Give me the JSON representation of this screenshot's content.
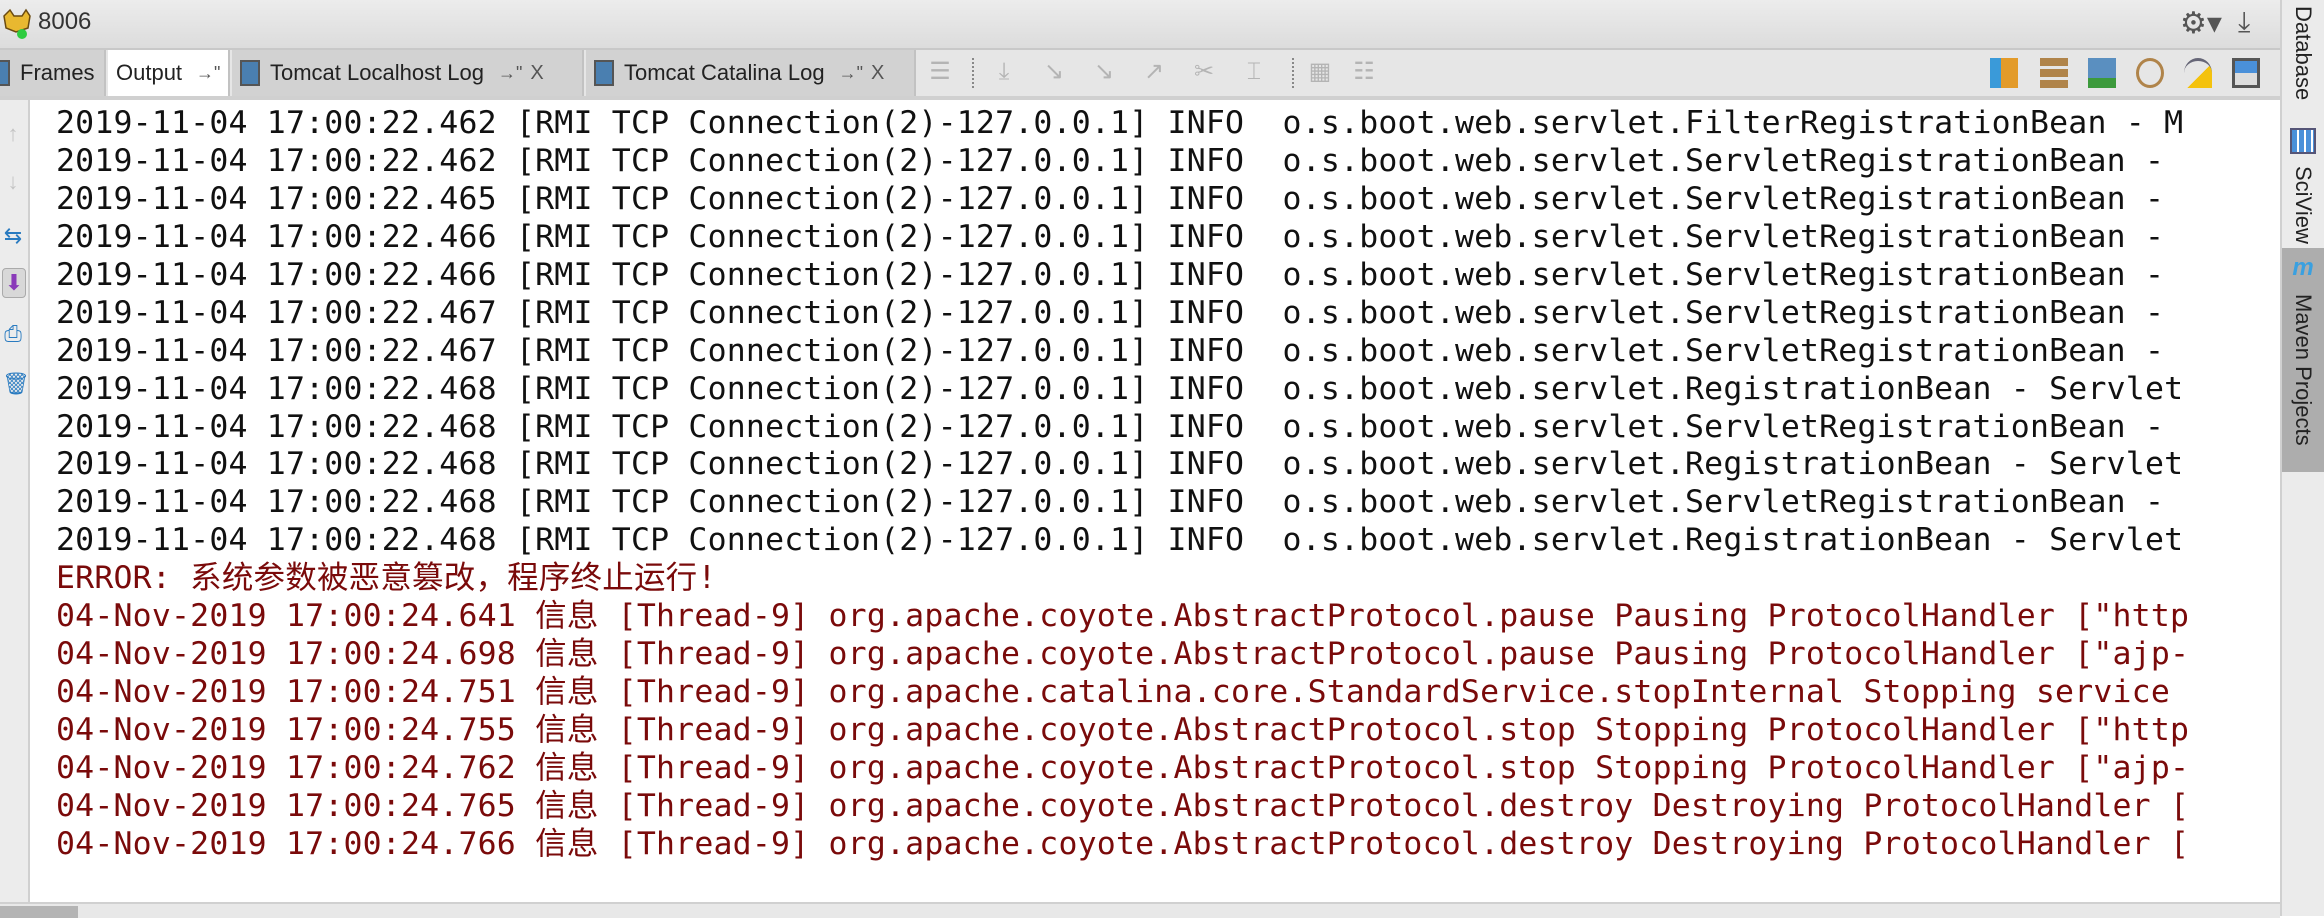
{
  "window": {
    "title": "8006"
  },
  "tabs": [
    {
      "label": "Frames"
    },
    {
      "label": "Output",
      "pin": "→\""
    },
    {
      "label": "Tomcat Localhost Log",
      "pin": "→\"",
      "close": "X"
    },
    {
      "label": "Tomcat Catalina Log",
      "pin": "→\"",
      "close": "X"
    }
  ],
  "right_sidebar": {
    "items": [
      {
        "label": "Database"
      },
      {
        "label": "SciView"
      },
      {
        "label": "Maven Projects",
        "icon_text": "m"
      }
    ]
  },
  "console": {
    "info_lines": [
      "2019-11-04 17:00:22.462 [RMI TCP Connection(2)-127.0.0.1] INFO  o.s.boot.web.servlet.FilterRegistrationBean - M",
      "2019-11-04 17:00:22.462 [RMI TCP Connection(2)-127.0.0.1] INFO  o.s.boot.web.servlet.ServletRegistrationBean - ",
      "2019-11-04 17:00:22.465 [RMI TCP Connection(2)-127.0.0.1] INFO  o.s.boot.web.servlet.ServletRegistrationBean - ",
      "2019-11-04 17:00:22.466 [RMI TCP Connection(2)-127.0.0.1] INFO  o.s.boot.web.servlet.ServletRegistrationBean - ",
      "2019-11-04 17:00:22.466 [RMI TCP Connection(2)-127.0.0.1] INFO  o.s.boot.web.servlet.ServletRegistrationBean - ",
      "2019-11-04 17:00:22.467 [RMI TCP Connection(2)-127.0.0.1] INFO  o.s.boot.web.servlet.ServletRegistrationBean - ",
      "2019-11-04 17:00:22.467 [RMI TCP Connection(2)-127.0.0.1] INFO  o.s.boot.web.servlet.ServletRegistrationBean - ",
      "2019-11-04 17:00:22.468 [RMI TCP Connection(2)-127.0.0.1] INFO  o.s.boot.web.servlet.RegistrationBean - Servlet",
      "2019-11-04 17:00:22.468 [RMI TCP Connection(2)-127.0.0.1] INFO  o.s.boot.web.servlet.ServletRegistrationBean - ",
      "2019-11-04 17:00:22.468 [RMI TCP Connection(2)-127.0.0.1] INFO  o.s.boot.web.servlet.RegistrationBean - Servlet",
      "2019-11-04 17:00:22.468 [RMI TCP Connection(2)-127.0.0.1] INFO  o.s.boot.web.servlet.ServletRegistrationBean - ",
      "2019-11-04 17:00:22.468 [RMI TCP Connection(2)-127.0.0.1] INFO  o.s.boot.web.servlet.RegistrationBean - Servlet"
    ],
    "error_lines": [
      "ERROR: 系统参数被恶意篡改，程序终止运行!",
      "04-Nov-2019 17:00:24.641 信息 [Thread-9] org.apache.coyote.AbstractProtocol.pause Pausing ProtocolHandler [\"http",
      "04-Nov-2019 17:00:24.698 信息 [Thread-9] org.apache.coyote.AbstractProtocol.pause Pausing ProtocolHandler [\"ajp-",
      "04-Nov-2019 17:00:24.751 信息 [Thread-9] org.apache.catalina.core.StandardService.stopInternal Stopping service ",
      "04-Nov-2019 17:00:24.755 信息 [Thread-9] org.apache.coyote.AbstractProtocol.stop Stopping ProtocolHandler [\"http",
      "04-Nov-2019 17:00:24.762 信息 [Thread-9] org.apache.coyote.AbstractProtocol.stop Stopping ProtocolHandler [\"ajp-",
      "04-Nov-2019 17:00:24.765 信息 [Thread-9] org.apache.coyote.AbstractProtocol.destroy Destroying ProtocolHandler [",
      "04-Nov-2019 17:00:24.766 信息 [Thread-9] org.apache.coyote.AbstractProtocol.destroy Destroying ProtocolHandler ["
    ]
  },
  "colors": {
    "info_text": "#111111",
    "error_text": "#7a0a0a",
    "active_tab": "#ffffff",
    "maven_tab": "#adadad"
  }
}
